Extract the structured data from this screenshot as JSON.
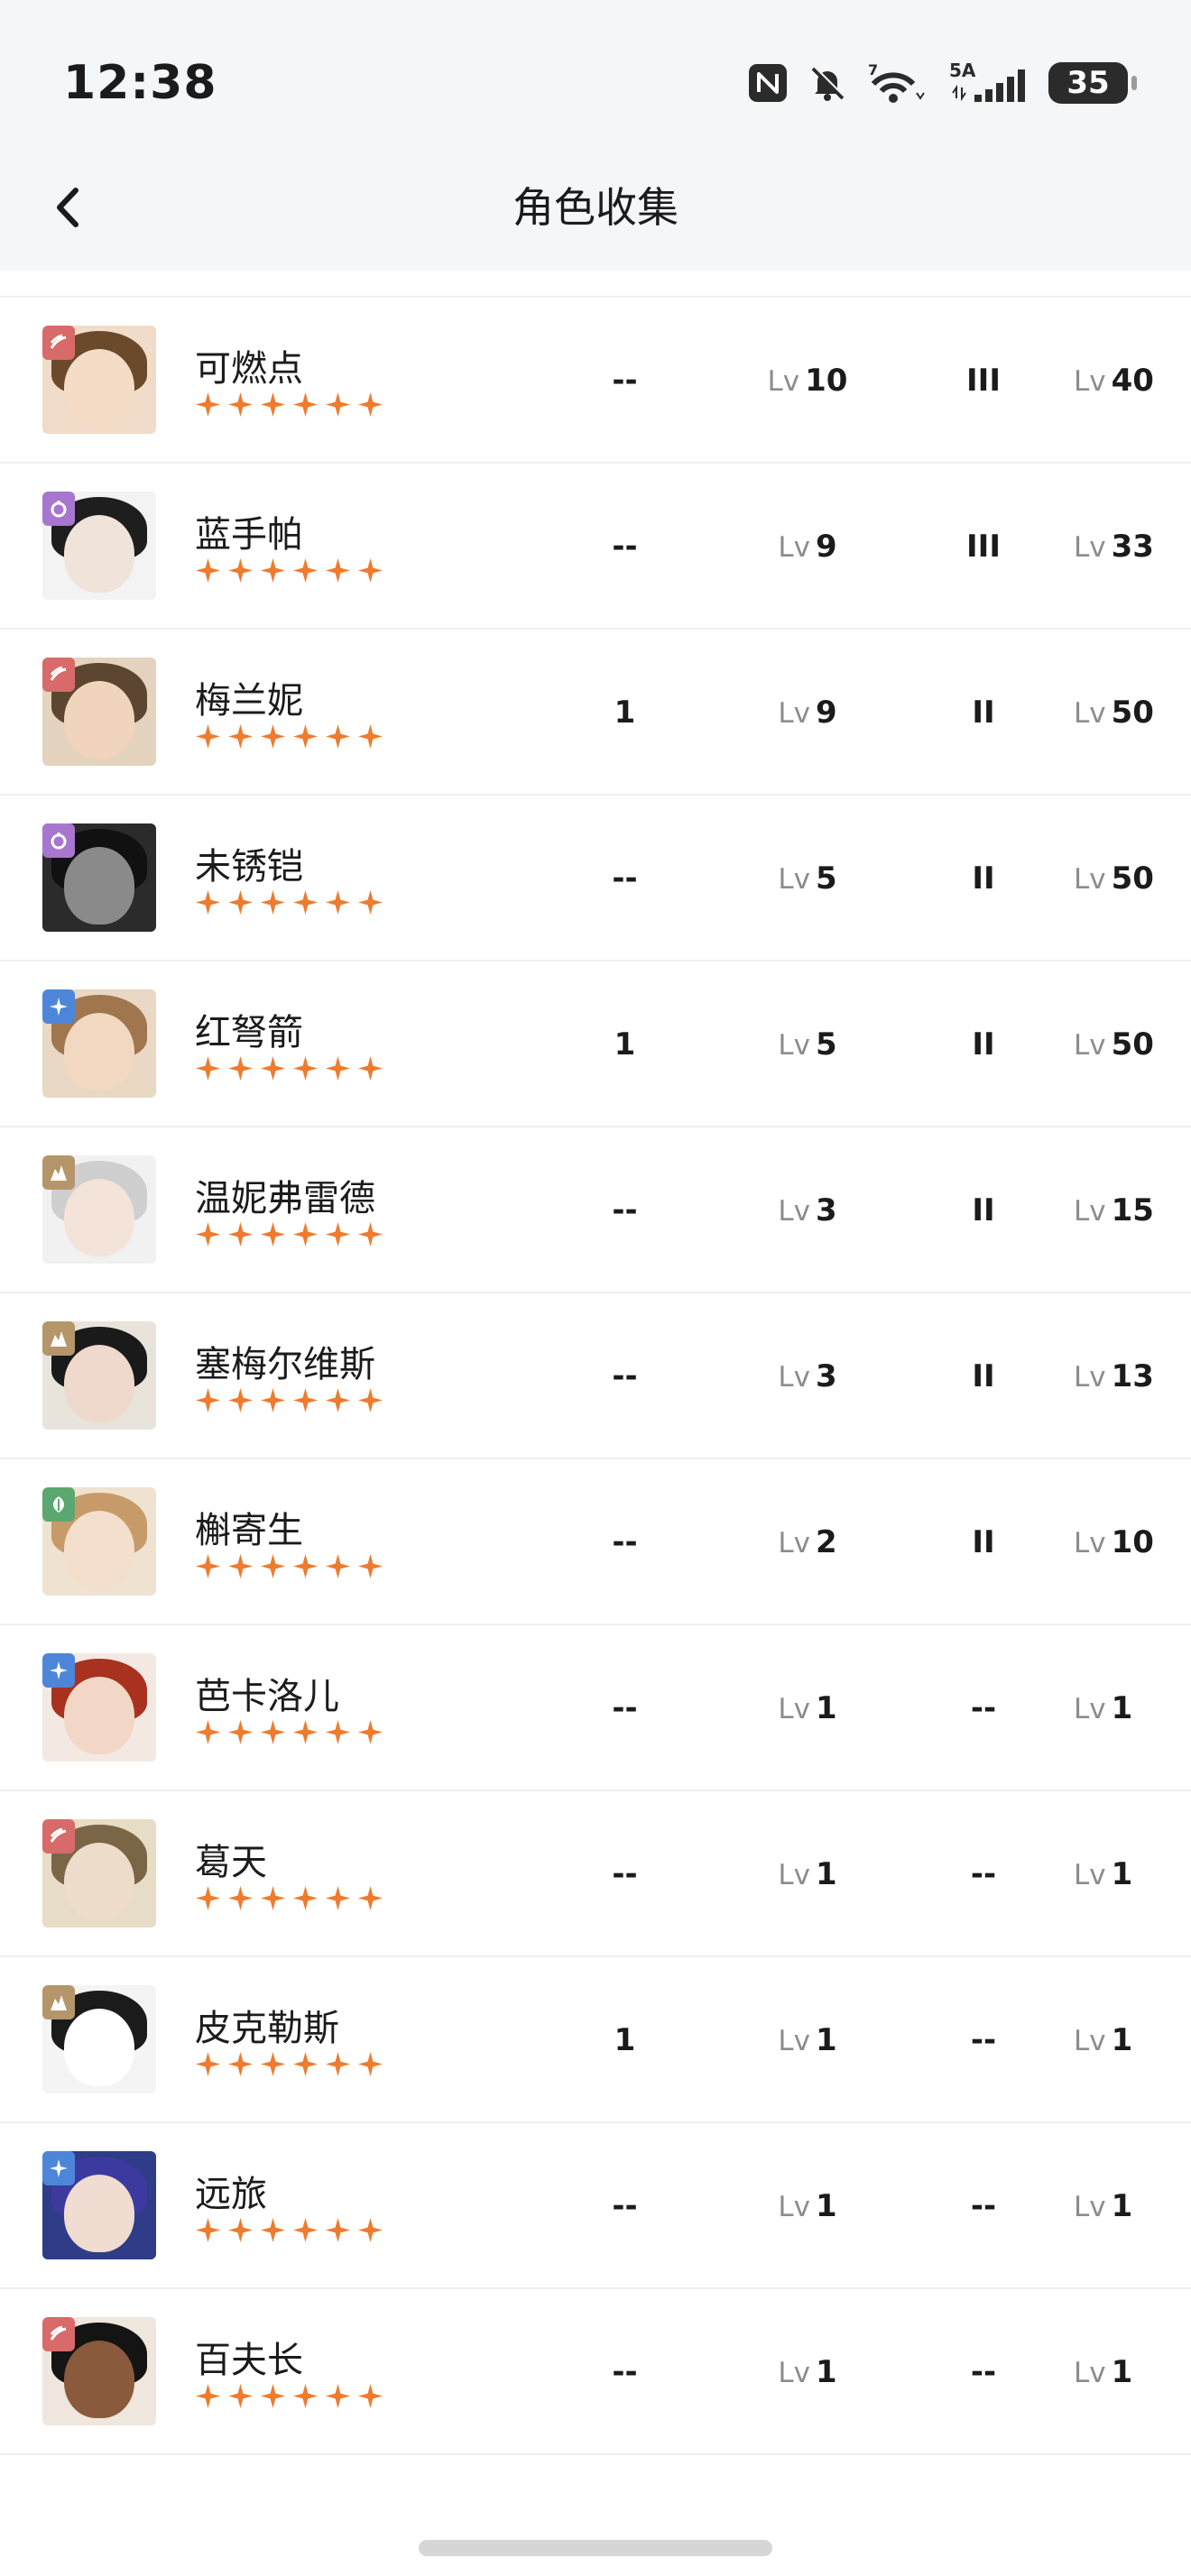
{
  "status_bar": {
    "time": "12:38",
    "network_label": "5A",
    "wifi_label": "7",
    "battery": "35"
  },
  "header": {
    "title": "角色收集",
    "back_icon": "chevron-left-icon"
  },
  "colors": {
    "star": "#ee7b2e",
    "element_fire": "#d86a6a",
    "element_void": "#a777cf",
    "element_ice": "#4d86d8",
    "element_rock": "#b4966a",
    "element_nature": "#5aa770"
  },
  "characters": [
    {
      "name": "可燃点",
      "element": "fire",
      "stars": 6,
      "const": "--",
      "lv_label": "Lv",
      "weapon_lv": "10",
      "rank": "III",
      "level": "40"
    },
    {
      "name": "蓝手帕",
      "element": "void",
      "stars": 6,
      "const": "--",
      "lv_label": "Lv",
      "weapon_lv": "9",
      "rank": "III",
      "level": "33"
    },
    {
      "name": "梅兰妮",
      "element": "fire",
      "stars": 6,
      "const": "1",
      "lv_label": "Lv",
      "weapon_lv": "9",
      "rank": "II",
      "level": "50"
    },
    {
      "name": "未锈铠",
      "element": "void",
      "stars": 6,
      "const": "--",
      "lv_label": "Lv",
      "weapon_lv": "5",
      "rank": "II",
      "level": "50"
    },
    {
      "name": "红弩箭",
      "element": "ice",
      "stars": 6,
      "const": "1",
      "lv_label": "Lv",
      "weapon_lv": "5",
      "rank": "II",
      "level": "50"
    },
    {
      "name": "温妮弗雷德",
      "element": "rock",
      "stars": 6,
      "const": "--",
      "lv_label": "Lv",
      "weapon_lv": "3",
      "rank": "II",
      "level": "15"
    },
    {
      "name": "塞梅尔维斯",
      "element": "rock",
      "stars": 6,
      "const": "--",
      "lv_label": "Lv",
      "weapon_lv": "3",
      "rank": "II",
      "level": "13"
    },
    {
      "name": "槲寄生",
      "element": "nature",
      "stars": 6,
      "const": "--",
      "lv_label": "Lv",
      "weapon_lv": "2",
      "rank": "II",
      "level": "10"
    },
    {
      "name": "芭卡洛儿",
      "element": "ice",
      "stars": 6,
      "const": "--",
      "lv_label": "Lv",
      "weapon_lv": "1",
      "rank": "--",
      "level": "1"
    },
    {
      "name": "葛天",
      "element": "fire",
      "stars": 6,
      "const": "--",
      "lv_label": "Lv",
      "weapon_lv": "1",
      "rank": "--",
      "level": "1"
    },
    {
      "name": "皮克勒斯",
      "element": "rock",
      "stars": 6,
      "const": "1",
      "lv_label": "Lv",
      "weapon_lv": "1",
      "rank": "--",
      "level": "1"
    },
    {
      "name": "远旅",
      "element": "ice",
      "stars": 6,
      "const": "--",
      "lv_label": "Lv",
      "weapon_lv": "1",
      "rank": "--",
      "level": "1"
    },
    {
      "name": "百夫长",
      "element": "fire",
      "stars": 6,
      "const": "--",
      "lv_label": "Lv",
      "weapon_lv": "1",
      "rank": "--",
      "level": "1"
    }
  ]
}
